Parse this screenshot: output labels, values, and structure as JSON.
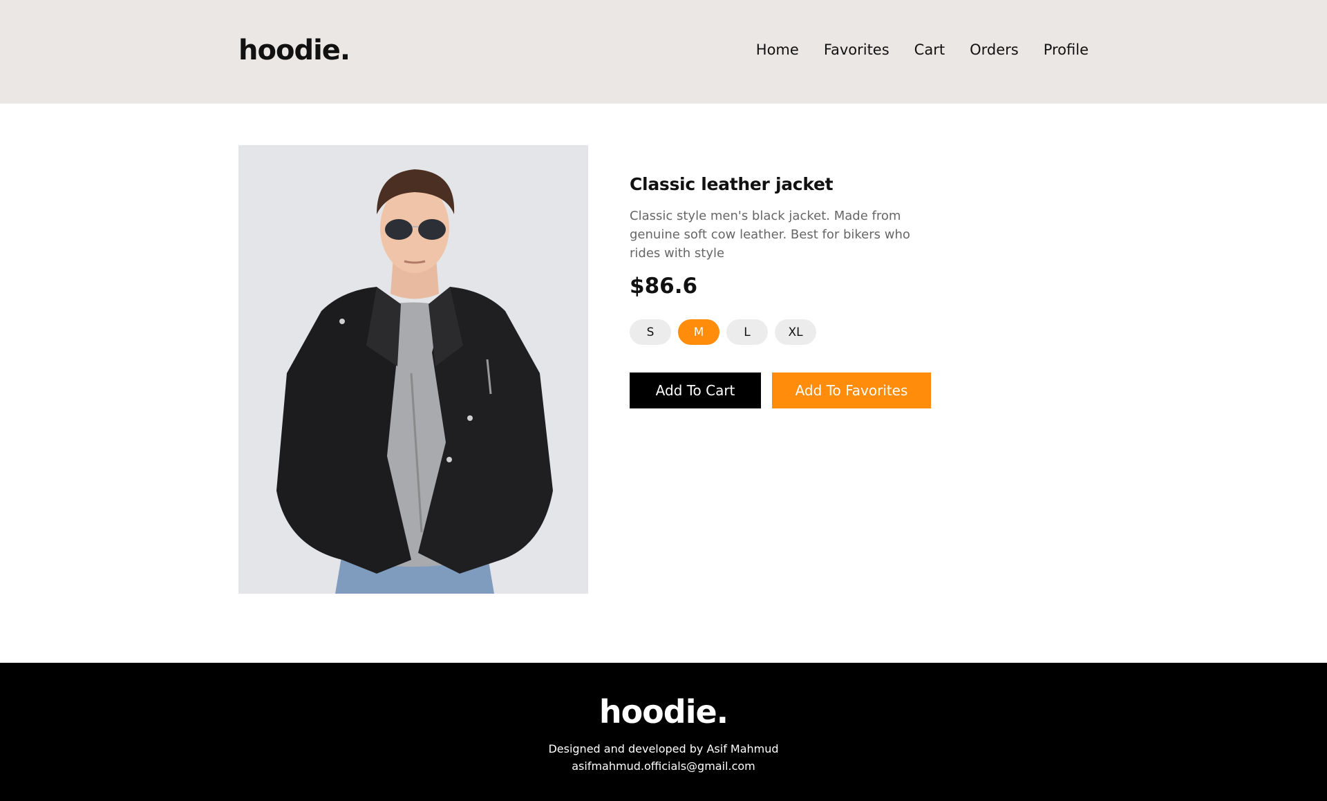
{
  "header": {
    "logo": "hoodie.",
    "nav": [
      "Home",
      "Favorites",
      "Cart",
      "Orders",
      "Profile"
    ]
  },
  "product": {
    "title": "Classic leather jacket",
    "description": "Classic style men's black jacket. Made from genuine soft cow leather. Best for bikers who rides with style",
    "price": "$86.6",
    "sizes": [
      "S",
      "M",
      "L",
      "XL"
    ],
    "selected_size": "M",
    "add_to_cart_label": "Add To Cart",
    "add_to_favorites_label": "Add To Favorites"
  },
  "footer": {
    "logo": "hoodie.",
    "credit": "Designed and developed by Asif Mahmud",
    "email": "asifmahmud.officials@gmail.com"
  },
  "colors": {
    "accent": "#ff8c0a",
    "header_bg": "#ebe7e5",
    "footer_bg": "#000000"
  }
}
